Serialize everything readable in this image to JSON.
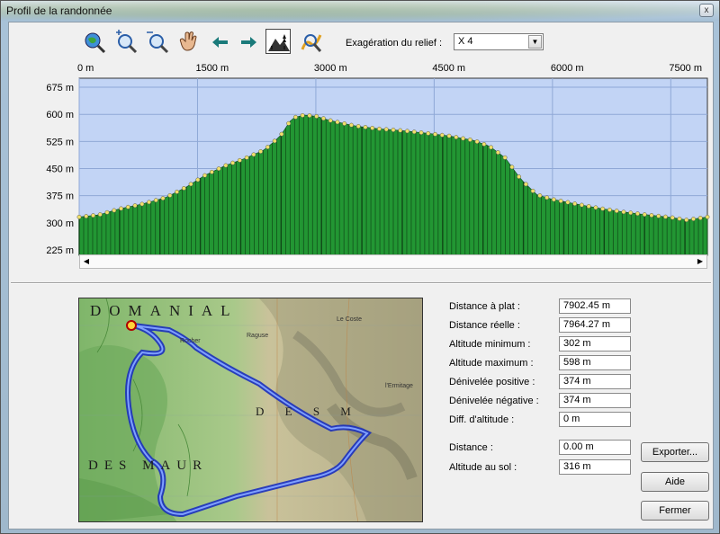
{
  "window": {
    "title": "Profil de la randonnée",
    "close_label": "x"
  },
  "toolbar": {
    "relief_label": "Exagération du relief :",
    "relief_value": "X 4",
    "tools": [
      "zoom-globe-icon",
      "zoom-in-icon",
      "zoom-out-icon",
      "pan-hand-icon",
      "arrow-left-icon",
      "arrow-right-icon",
      "relief-view-icon",
      "trail-zoom-icon"
    ]
  },
  "profile": {
    "x_ticks": [
      "0 m",
      "1500 m",
      "3000 m",
      "4500 m",
      "6000 m",
      "7500 m"
    ],
    "y_ticks": [
      "675 m",
      "600 m",
      "525 m",
      "450 m",
      "375 m",
      "300 m",
      "225 m"
    ],
    "colors": {
      "sky": "#c2d4f5",
      "fill": "#229633",
      "grid": "#8fa8d6",
      "point": "#f0e06a"
    }
  },
  "chart_data": {
    "type": "area",
    "xlabel": "",
    "ylabel": "",
    "xlim": [
      0,
      7964
    ],
    "ylim": [
      210,
      700
    ],
    "x": [
      0,
      250,
      500,
      800,
      1100,
      1350,
      1600,
      1850,
      2100,
      2350,
      2550,
      2700,
      2850,
      3000,
      3200,
      3500,
      3800,
      4100,
      4400,
      4700,
      5000,
      5200,
      5400,
      5600,
      5800,
      6000,
      6300,
      6600,
      6900,
      7200,
      7500,
      7700,
      7964
    ],
    "series": [
      {
        "values": [
          316,
          322,
          338,
          352,
          370,
          398,
          432,
          458,
          478,
          502,
          540,
          590,
          598,
          595,
          582,
          568,
          560,
          555,
          548,
          540,
          528,
          512,
          480,
          420,
          378,
          365,
          352,
          340,
          330,
          322,
          315,
          308,
          316
        ]
      }
    ]
  },
  "map": {
    "labels": [
      "DOMANIAL",
      "DES MAUR",
      "D E S M",
      "Le Coste",
      "l'Ermitage",
      "Raguse",
      "Rocher"
    ],
    "route_color": "#2b4fe0"
  },
  "stats": [
    {
      "label": "Distance à plat :",
      "value": "7902.45 m"
    },
    {
      "label": "Distance réelle :",
      "value": "7964.27 m"
    },
    {
      "label": "Altitude minimum :",
      "value": "302 m"
    },
    {
      "label": "Altitude maximum :",
      "value": "598 m"
    },
    {
      "label": "Dénivelée positive :",
      "value": "374 m"
    },
    {
      "label": "Dénivelée négative :",
      "value": "374 m"
    },
    {
      "label": "Diff. d'altitude :",
      "value": "0 m"
    }
  ],
  "cursor": [
    {
      "label": "Distance :",
      "value": "0.00 m"
    },
    {
      "label": "Altitude au sol :",
      "value": "316 m"
    }
  ],
  "buttons": {
    "export": "Exporter...",
    "help": "Aide",
    "close": "Fermer"
  }
}
